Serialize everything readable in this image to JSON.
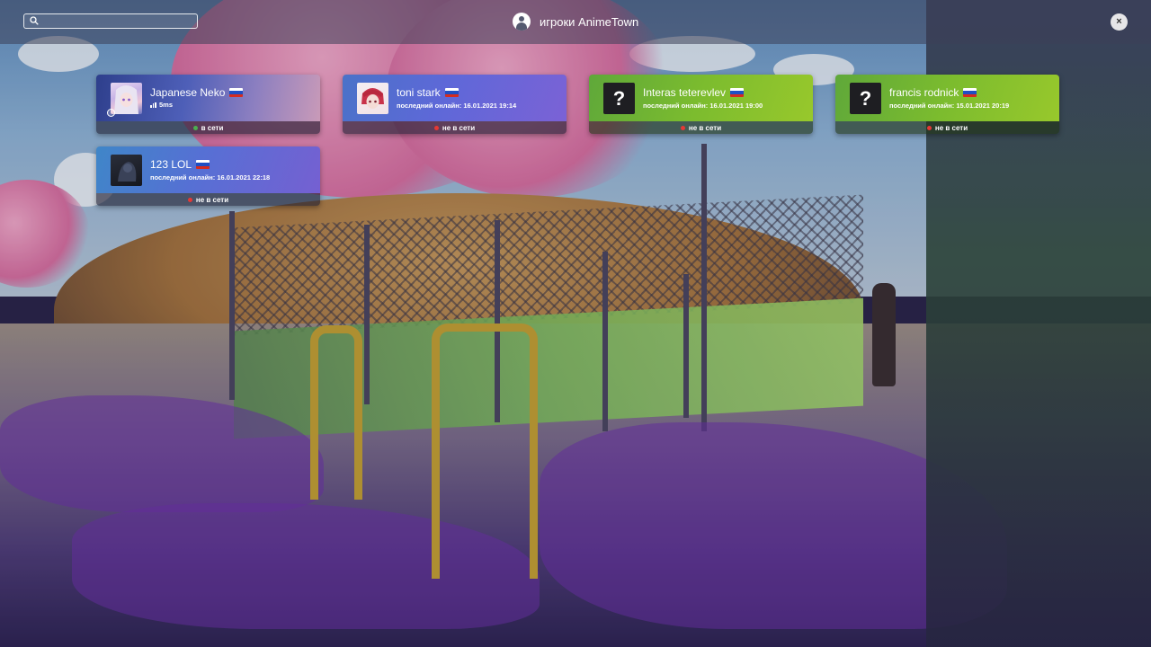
{
  "header": {
    "title": "игроки AnimeTown",
    "user_icon": "user-icon",
    "close_label": "×"
  },
  "search": {
    "value": "",
    "placeholder": "",
    "icon": "search-icon"
  },
  "colors": {
    "online": "#4caf50",
    "offline": "#e53935",
    "card_purple": "#6c5ce7",
    "card_green": "#7cb82f"
  },
  "players": [
    {
      "name": "Japanese Neko",
      "flag": "russia-flag",
      "ping": "5ms",
      "status": "в сети",
      "online": true
    },
    {
      "name": "toni stark",
      "flag": "russia-flag",
      "last_online": "последний онлайн: 16.01.2021 19:14",
      "status": "не в сети",
      "online": false
    },
    {
      "name": "Interas teterevlev",
      "flag": "russia-flag",
      "avatar_placeholder": "?",
      "last_online": "последний онлайн: 16.01.2021 19:00",
      "status": "не в сети",
      "online": false
    },
    {
      "name": "francis rodnick",
      "flag": "russia-flag",
      "avatar_placeholder": "?",
      "last_online": "последний онлайн: 15.01.2021 20:19",
      "status": "не в сети",
      "online": false
    },
    {
      "name": "123 LOL",
      "flag": "russia-flag",
      "last_online": "последний онлайн: 16.01.2021 22:18",
      "status": "не в сети",
      "online": false
    }
  ]
}
